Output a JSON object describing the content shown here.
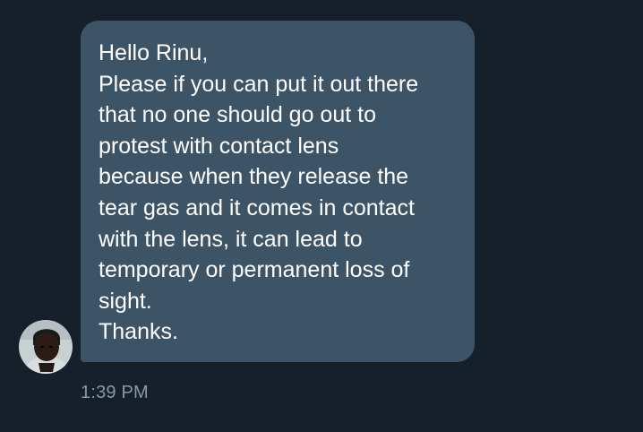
{
  "conversation": {
    "incoming_message": {
      "lines": [
        "Hello Rinu,",
        "Please if you can put it out there",
        "that no one should go out to",
        "protest with contact lens",
        "because when they release the",
        "tear gas and it comes in contact",
        "with the lens, it can lead to",
        "temporary or permanent loss of",
        "sight.",
        "Thanks."
      ],
      "timestamp": "1:39 PM"
    }
  },
  "colors": {
    "background": "#15202b",
    "bubble": "#3d5466",
    "message_text": "#ffffff",
    "timestamp_text": "#8899a6"
  }
}
